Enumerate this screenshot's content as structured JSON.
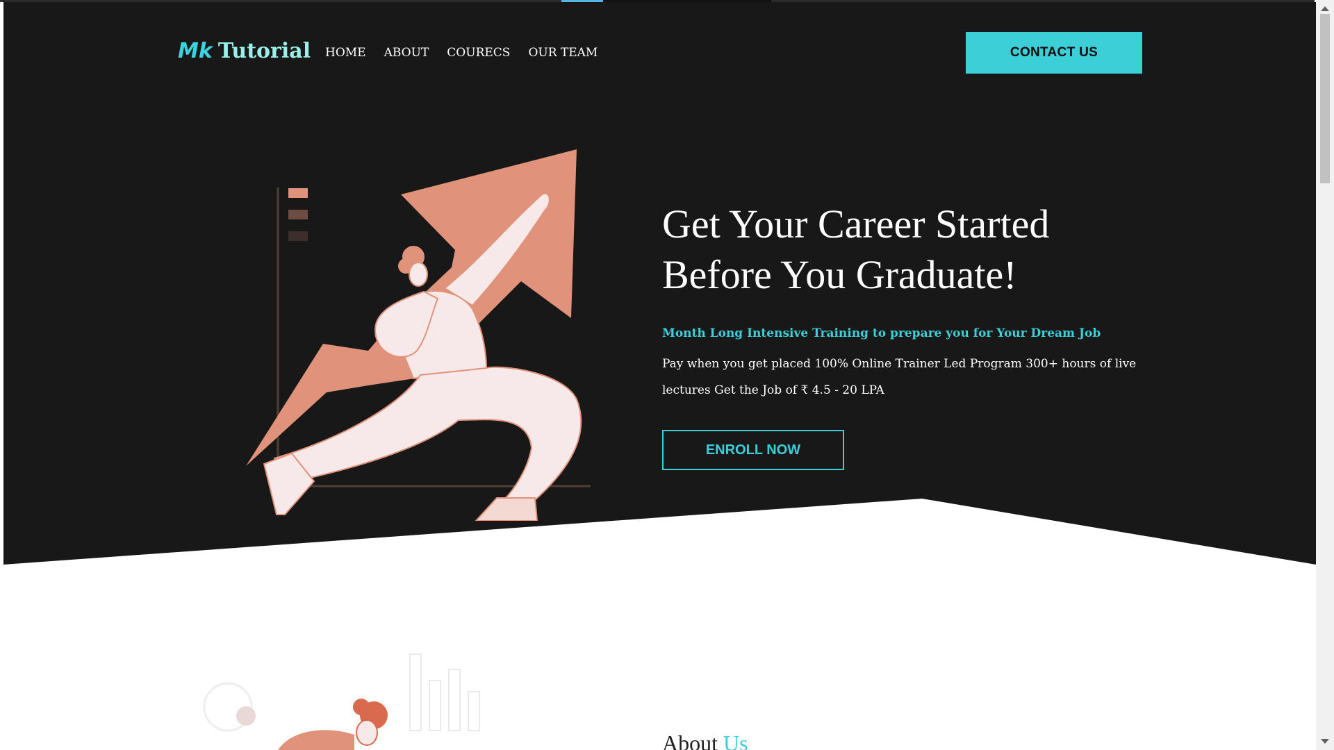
{
  "header": {
    "logo_mark": "Mk",
    "logo_text": "Tutorial",
    "nav": [
      "HOME",
      "ABOUT",
      "COURECS",
      "OUR TEAM"
    ],
    "contact_label": "CONTACT US"
  },
  "hero": {
    "title_line1": "Get Your Career Started",
    "title_line2": "Before You Graduate!",
    "subtitle": "Month Long Intensive Training to prepare you for Your Dream Job",
    "description": "Pay when you get placed 100% Online Trainer Led Program 300+ hours of live lectures Get the Job of ₹ 4.5 - 20 LPA",
    "enroll_label": "ENROLL NOW"
  },
  "about": {
    "title_main": "About",
    "title_accent": "Us"
  },
  "colors": {
    "accent": "#3ccfd8",
    "hero_bg": "#181818",
    "illustration": "#e0927a",
    "figure": "#f7e9e9"
  },
  "icons": {
    "hero_illustration": "man-pushing-growth-arrow",
    "about_illustration": "person-with-bar-chart"
  }
}
